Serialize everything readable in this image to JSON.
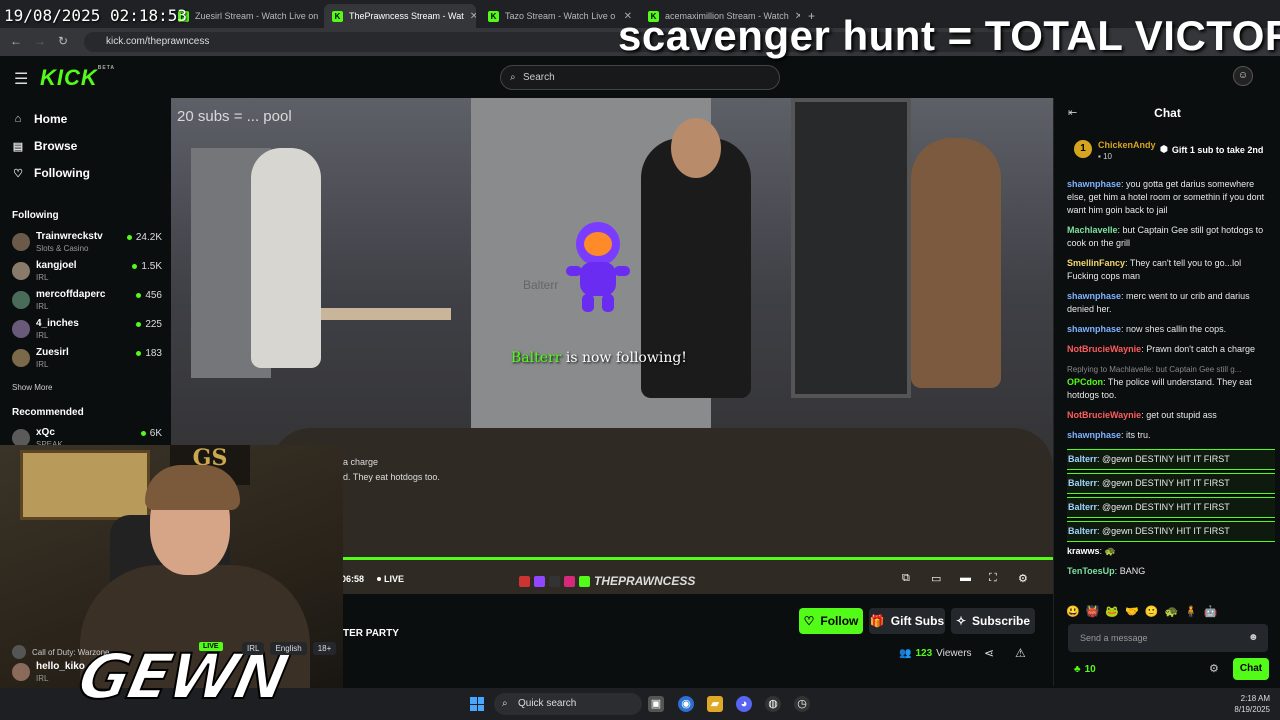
{
  "overlay": {
    "timestamp": "19/08/2025 02:18:53",
    "title": "scavenger hunt = TOTAL VICTOR",
    "video_sub": "20 subs = ... pool",
    "follow_alert_user": "Balterr",
    "follow_alert_text": " is now following!",
    "faded_name": "Balterr",
    "streamer_logo": "GEWN"
  },
  "browser": {
    "tabs": [
      {
        "label": "Zuesirl Stream - Watch Live on"
      },
      {
        "label": "ThePrawncess Stream - Wat"
      },
      {
        "label": "Tazo Stream - Watch Live o"
      },
      {
        "label": "acemaximillion Stream - Watch"
      }
    ],
    "url": "kick.com/theprawncess"
  },
  "topnav": {
    "logo": "KICK",
    "logo_badge": "BETA",
    "search_placeholder": "Search"
  },
  "sidebar": {
    "nav": [
      {
        "label": "Home"
      },
      {
        "label": "Browse"
      },
      {
        "label": "Following"
      }
    ],
    "following_header": "Following",
    "following": [
      {
        "name": "Trainwreckstv",
        "category": "Slots & Casino",
        "viewers": "24.2K"
      },
      {
        "name": "kangjoel",
        "category": "IRL",
        "viewers": "1.5K"
      },
      {
        "name": "mercoffdaperc",
        "category": "IRL",
        "viewers": "456"
      },
      {
        "name": "4_inches",
        "category": "IRL",
        "viewers": "225"
      },
      {
        "name": "Zuesirl",
        "category": "IRL",
        "viewers": "183"
      }
    ],
    "show_more": "Show More",
    "recommended_header": "Recommended",
    "recommended": [
      {
        "name": "xQc",
        "category": "SPEAK",
        "viewers": "6K"
      }
    ],
    "bottom_category": "Call of Duty: Warzone",
    "bottom_channel": {
      "name": "hello_kiko",
      "category": "IRL"
    }
  },
  "player": {
    "time": "06:58",
    "live_label": "LIVE",
    "watermark": "THEPRAWNCESS",
    "webcam_chat_leak": [
      "a charge",
      "d. They eat hotdogs too."
    ]
  },
  "stream_info": {
    "title_fragment": "TER PARTY",
    "live_badge": "LIVE",
    "tags": [
      "IRL",
      "English",
      "18+"
    ],
    "follow_label": "Follow",
    "gift_subs_label": "Gift Subs",
    "subscribe_label": "Subscribe",
    "viewers_count": "123",
    "viewers_label": "Viewers"
  },
  "chat": {
    "header": "Chat",
    "pinned": {
      "rank": "1",
      "user": "ChickenAndy",
      "count": "10",
      "gift_text": "Gift 1 sub to take 2nd"
    },
    "messages": [
      {
        "user": "shawnphase",
        "color": "#7fb3ff",
        "text": "you gotta get darius somewhere else, get him a hotel room or somethin if you dont want him goin back to jail"
      },
      {
        "user": "Machlavelle",
        "color": "#7ee0a0",
        "text": "but Captain Gee still got hotdogs to cook on the grill"
      },
      {
        "user": "SmellinFancy",
        "color": "#f5d76e",
        "text": "They can't tell you to go...lol Fucking cops man"
      },
      {
        "user": "shawnphase",
        "color": "#7fb3ff",
        "text": "merc went to ur crib and darius denied her."
      },
      {
        "user": "shawnphase",
        "color": "#7fb3ff",
        "text": "now shes callin the cops."
      },
      {
        "user": "NotBrucieWaynie",
        "color": "#ff5c5c",
        "text": "Prawn don't catch a charge"
      },
      {
        "reply": "Replying to Machlavelle: but Captain Gee still g...",
        "user": "OPCdon",
        "color": "#53fc18",
        "text": "The police will understand. They eat hotdogs too."
      },
      {
        "user": "NotBrucieWaynie",
        "color": "#ff5c5c",
        "text": "get out stupid ass"
      },
      {
        "user": "shawnphase",
        "color": "#7fb3ff",
        "text": "its tru."
      },
      {
        "user": "Balterr",
        "color": "#9fd3ff",
        "text": "@gewn DESTINY HIT IT FIRST",
        "highlight": true
      },
      {
        "user": "Balterr",
        "color": "#9fd3ff",
        "text": "@gewn DESTINY HIT IT FIRST",
        "highlight": true
      },
      {
        "user": "Balterr",
        "color": "#9fd3ff",
        "text": "@gewn DESTINY HIT IT FIRST",
        "highlight": true
      },
      {
        "user": "Balterr",
        "color": "#9fd3ff",
        "text": "@gewn DESTINY HIT IT FIRST",
        "highlight": true
      },
      {
        "user": "krawws",
        "color": "#ffffff",
        "text": "🐢"
      },
      {
        "user": "TenToesUp",
        "color": "#7ee0a0",
        "text": "BANG"
      }
    ],
    "input_placeholder": "Send a message",
    "points": "10",
    "send_label": "Chat"
  },
  "taskbar": {
    "search_label": "Quick search",
    "time": "2:18 AM",
    "date": "8/19/2025"
  },
  "colors": {
    "accent": "#53fc18"
  }
}
